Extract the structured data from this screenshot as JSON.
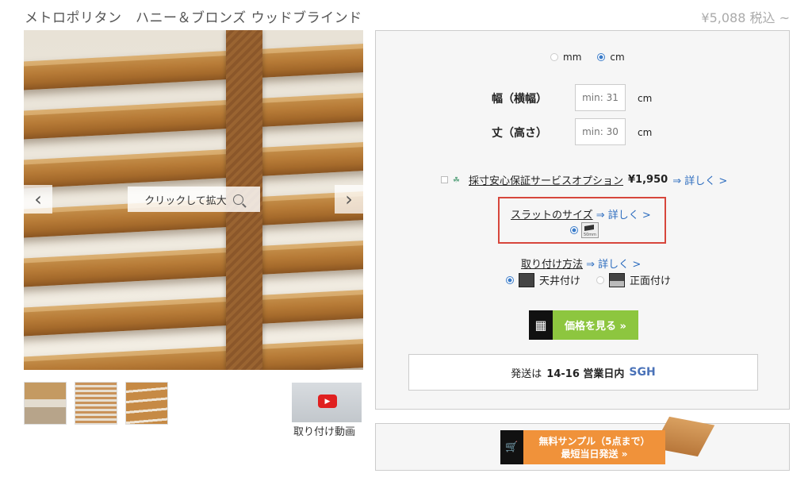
{
  "header": {
    "title": "メトロポリタン　ハニー＆ブロンズ ウッドブラインド",
    "price": "¥5,088 税込 ~"
  },
  "gallery": {
    "zoom_label": "クリックして拡大",
    "prev": "‹",
    "next": "›",
    "video_label": "取り付け動画",
    "play_symbol": "▶"
  },
  "config": {
    "units": [
      {
        "label": "mm",
        "selected": false
      },
      {
        "label": "cm",
        "selected": true
      }
    ],
    "width": {
      "label": "幅（横幅）",
      "placeholder": "min: 31",
      "unit": "cm"
    },
    "height": {
      "label": "丈（高さ）",
      "placeholder": "min: 30",
      "unit": "cm"
    },
    "measure_option": {
      "label": "採寸安心保証サービスオプション",
      "price": "¥1,950",
      "details_link": "⇒ 詳しく >"
    },
    "slat_size": {
      "label": "スラットのサイズ",
      "details_link": "⇒ 詳しく >",
      "swatch_caption": "50mm"
    },
    "mount": {
      "label": "取り付け方法",
      "details_link": "⇒ 詳しく >",
      "options": [
        {
          "label": "天井付け",
          "selected": true
        },
        {
          "label": "正面付け",
          "selected": false
        }
      ]
    },
    "price_button": {
      "label": "価格を見る »",
      "icon": "calculator-icon"
    },
    "shipping": {
      "prefix": "発送は",
      "days": "14-16 営業日内",
      "logo": "SGH"
    }
  },
  "sample": {
    "line1": "無料サンプル（5点まで）",
    "line2": "最短当日発送 »",
    "icon": "cart-icon"
  },
  "colors": {
    "accent_green": "#8dc63f",
    "accent_orange": "#f0923a",
    "highlight_red": "#d7463c",
    "link_blue": "#2d6dbf"
  }
}
